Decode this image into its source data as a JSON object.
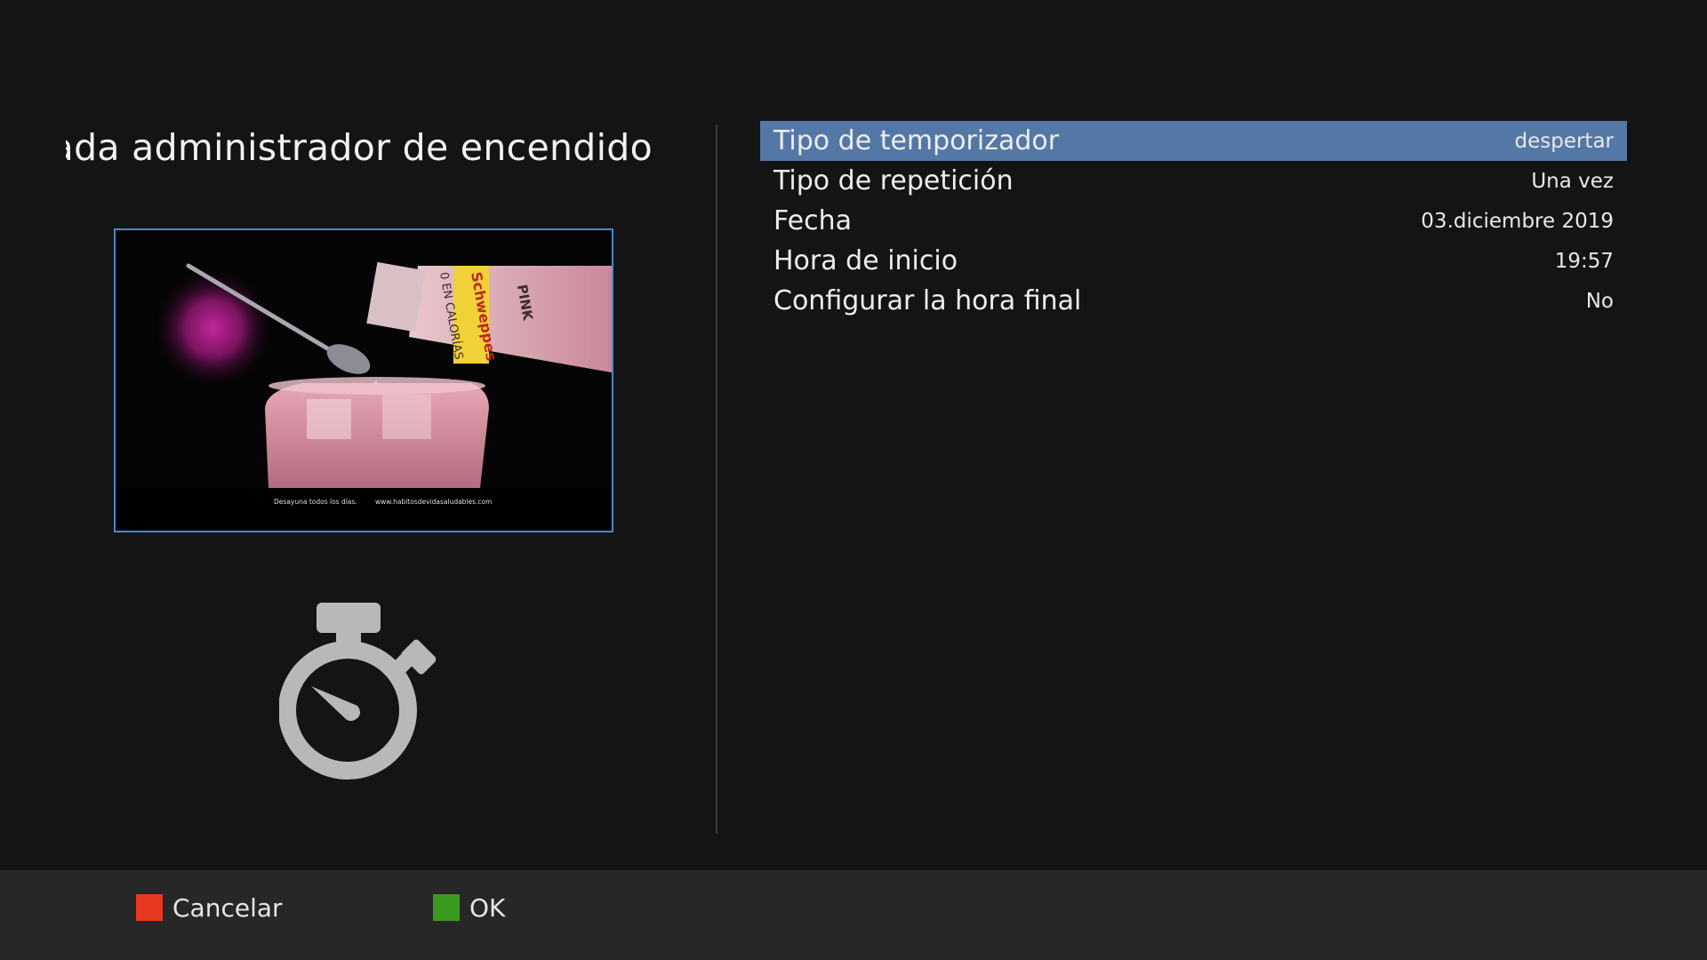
{
  "title": "Entrada administrador de encendido",
  "preview": {
    "caption_left": "Desayuna todos los días.",
    "caption_right": "www.habitosdevidasaludables.com",
    "bottle_brand": "Schweppes",
    "bottle_variant": "PINK",
    "bottle_side_text": "0 EN CALORÍAS"
  },
  "settings": [
    {
      "label": "Tipo de temporizador",
      "value": "despertar",
      "selected": true
    },
    {
      "label": "Tipo de repetición",
      "value": "Una vez",
      "selected": false
    },
    {
      "label": "Fecha",
      "value": "03.diciembre 2019",
      "selected": false
    },
    {
      "label": "Hora de inicio",
      "value": "19:57",
      "selected": false
    },
    {
      "label": "Configurar la hora final",
      "value": "No",
      "selected": false
    }
  ],
  "footer": {
    "cancel_label": "Cancelar",
    "ok_label": "OK",
    "cancel_color": "#e8381e",
    "ok_color": "#3a9a1e"
  },
  "icons": {
    "timer": "stopwatch-icon"
  },
  "colors": {
    "selection": "#5478a6",
    "background": "#141414",
    "footer_bg": "#272727",
    "preview_border": "#4d86c8"
  }
}
